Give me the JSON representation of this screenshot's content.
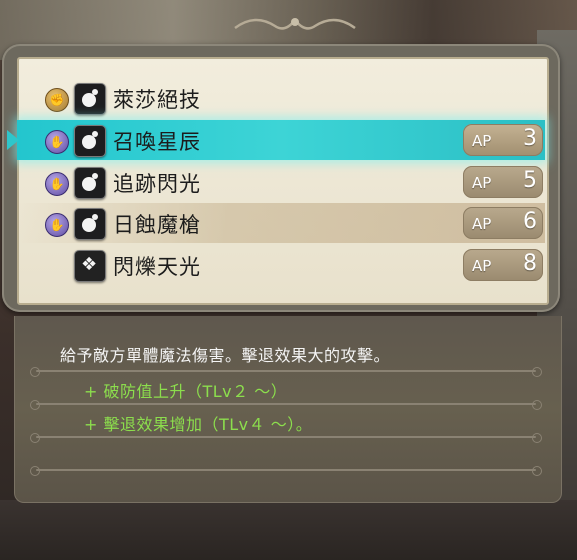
{
  "skills": [
    {
      "name": "萊莎絕技",
      "badge": "fist-icon",
      "icon": "burst-icon",
      "ap_label": "",
      "ap": "",
      "selected": false
    },
    {
      "name": "召喚星辰",
      "badge": "hand-icon",
      "icon": "burst-icon",
      "ap_label": "AP",
      "ap": "3",
      "selected": true
    },
    {
      "name": "追跡閃光",
      "badge": "hand-icon",
      "icon": "burst-icon",
      "ap_label": "AP",
      "ap": "5",
      "selected": false
    },
    {
      "name": "日蝕魔槍",
      "badge": "hand-icon",
      "icon": "burst-icon",
      "ap_label": "AP",
      "ap": "6",
      "selected": false
    },
    {
      "name": "閃爍天光",
      "badge": "",
      "icon": "wolf-icon",
      "ap_label": "AP",
      "ap": "8",
      "selected": false
    }
  ],
  "description": {
    "text": "給予敵方單體魔法傷害。擊退效果大的攻擊。",
    "bonuses": [
      "+ 破防值上升（TLv２ ～）",
      "+ 擊退效果增加（TLv４ ～）。"
    ]
  },
  "colors": {
    "selected": "#2ec6cb",
    "bonus_text": "#8cde4d",
    "panel": "#ede6d2"
  }
}
